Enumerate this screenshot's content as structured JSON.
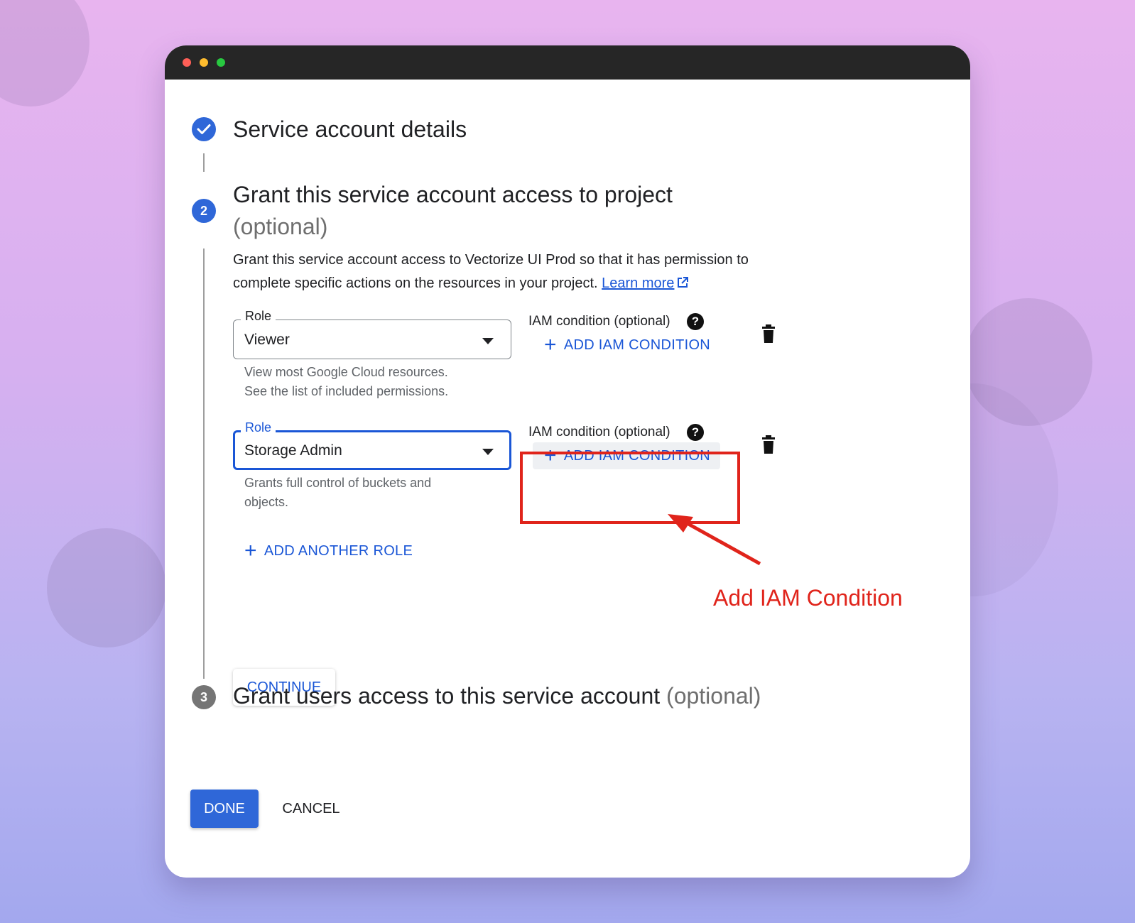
{
  "window": {
    "controls": [
      {
        "name": "close",
        "color": "#ff5f57"
      },
      {
        "name": "minimize",
        "color": "#febc2e"
      },
      {
        "name": "zoom",
        "color": "#28c840"
      }
    ]
  },
  "steps": [
    {
      "number": "",
      "icon": "check-circle-icon",
      "title": "Service account details",
      "optional": "",
      "status": "completed"
    },
    {
      "number": "2",
      "title": "Grant this service account access to project",
      "optional": "(optional)",
      "status": "active"
    },
    {
      "number": "3",
      "title": "Grant users access to this service account",
      "optional": "(optional)",
      "status": "pending"
    }
  ],
  "grant": {
    "description": "Grant this service account access to Vectorize UI Prod so that it has permission to complete specific actions on the resources in your project.",
    "learn_more": "Learn more",
    "roles": [
      {
        "legend": "Role",
        "value": "Viewer",
        "helper_line1": "View most Google Cloud resources.",
        "helper_line2": "See the list of included permissions.",
        "iam_label": "IAM condition (optional)",
        "add_condition": "ADD IAM CONDITION",
        "focused": false
      },
      {
        "legend": "Role",
        "value": "Storage Admin",
        "helper_line1": "Grants full control of buckets and",
        "helper_line2": "objects.",
        "iam_label": "IAM condition (optional)",
        "add_condition": "ADD IAM CONDITION",
        "focused": true
      }
    ],
    "add_another_role": "ADD ANOTHER ROLE",
    "continue": "CONTINUE"
  },
  "footer": {
    "done": "DONE",
    "cancel": "CANCEL"
  },
  "annotation": {
    "text": "Add IAM Condition",
    "color": "#e0241b"
  },
  "colors": {
    "accent": "#1a56d6",
    "primary_button": "#2f67d8",
    "completed": "#2f67d8",
    "pending": "#757575"
  }
}
